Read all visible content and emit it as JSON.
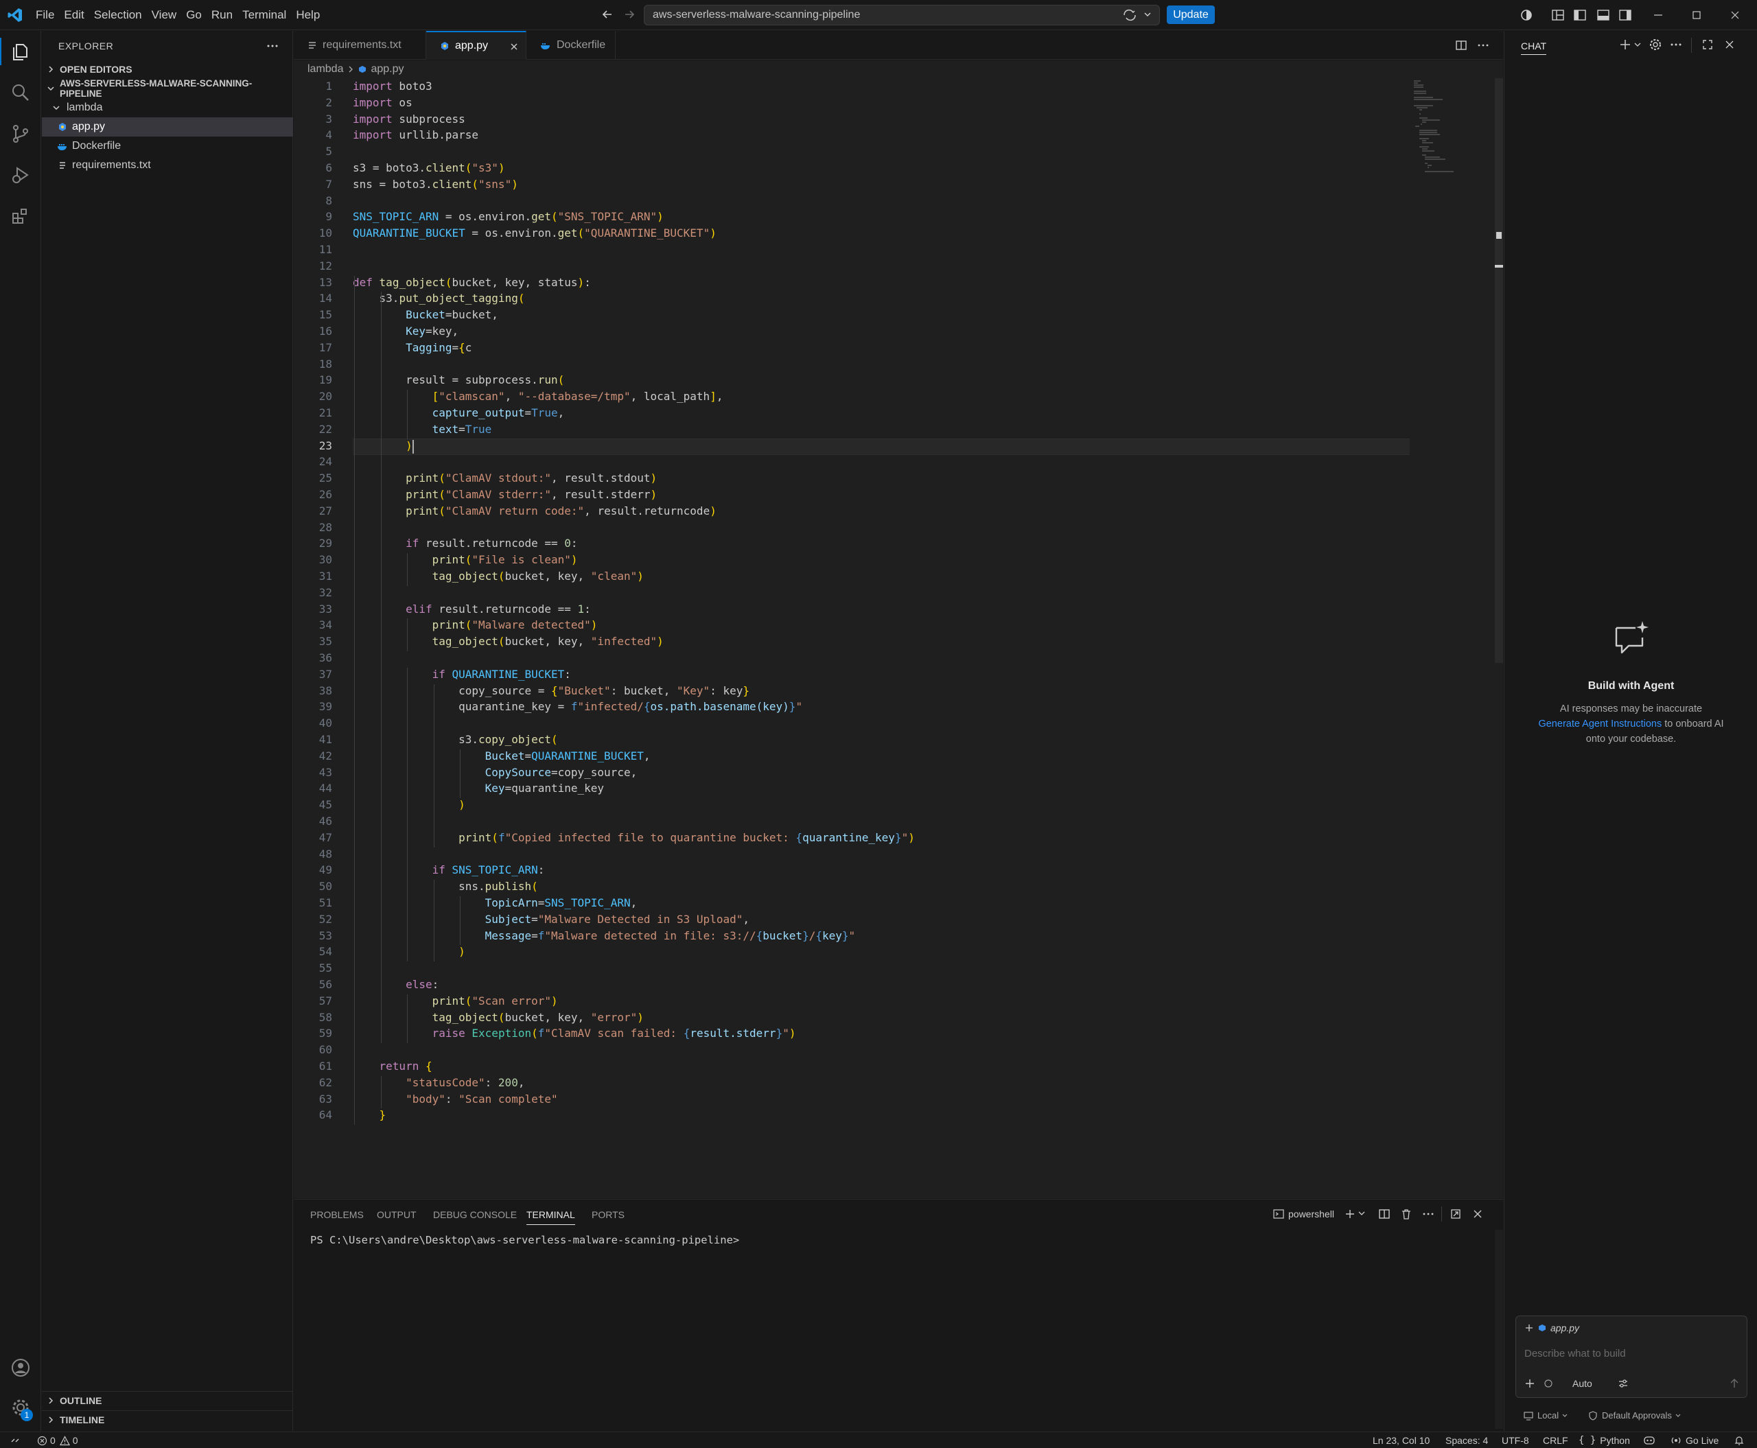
{
  "menu": [
    "File",
    "Edit",
    "Selection",
    "View",
    "Go",
    "Run",
    "Terminal",
    "Help"
  ],
  "command_center": {
    "text": "aws-serverless-malware-scanning-pipeline"
  },
  "update_label": "Update",
  "explorer": {
    "title": "EXPLORER",
    "open_editors": "OPEN EDITORS",
    "project": "AWS-SERVERLESS-MALWARE-SCANNING-PIPELINE",
    "folder": "lambda",
    "files": [
      "app.py",
      "Dockerfile",
      "requirements.txt"
    ],
    "outline": "OUTLINE",
    "timeline": "TIMELINE"
  },
  "tabs": [
    "requirements.txt",
    "app.py",
    "Dockerfile"
  ],
  "breadcrumb": {
    "folder": "lambda",
    "file": "app.py"
  },
  "code_lines": [
    "import boto3",
    "import os",
    "import subprocess",
    "import urllib.parse",
    "",
    "s3 = boto3.client(\"s3\")",
    "sns = boto3.client(\"sns\")",
    "",
    "SNS_TOPIC_ARN = os.environ.get(\"SNS_TOPIC_ARN\")",
    "QUARANTINE_BUCKET = os.environ.get(\"QUARANTINE_BUCKET\")",
    "",
    "",
    "def tag_object(bucket, key, status):",
    "    s3.put_object_tagging(",
    "        Bucket=bucket,",
    "        Key=key,",
    "        Tagging={c",
    "",
    "        result = subprocess.run(",
    "            [\"clamscan\", \"--database=/tmp\", local_path],",
    "            capture_output=True,",
    "            text=True",
    "        )",
    "",
    "        print(\"ClamAV stdout:\", result.stdout)",
    "        print(\"ClamAV stderr:\", result.stderr)",
    "        print(\"ClamAV return code:\", result.returncode)",
    "",
    "        if result.returncode == 0:",
    "            print(\"File is clean\")",
    "            tag_object(bucket, key, \"clean\")",
    "",
    "        elif result.returncode == 1:",
    "            print(\"Malware detected\")",
    "            tag_object(bucket, key, \"infected\")",
    "",
    "            if QUARANTINE_BUCKET:",
    "                copy_source = {\"Bucket\": bucket, \"Key\": key}",
    "                quarantine_key = f\"infected/{os.path.basename(key)}\"",
    "",
    "                s3.copy_object(",
    "                    Bucket=QUARANTINE_BUCKET,",
    "                    CopySource=copy_source,",
    "                    Key=quarantine_key",
    "                )",
    "",
    "                print(f\"Copied infected file to quarantine bucket: {quarantine_key}\")",
    "",
    "            if SNS_TOPIC_ARN:",
    "                sns.publish(",
    "                    TopicArn=SNS_TOPIC_ARN,",
    "                    Subject=\"Malware Detected in S3 Upload\",",
    "                    Message=f\"Malware detected in file: s3://{bucket}/{key}\"",
    "                )",
    "",
    "        else:",
    "            print(\"Scan error\")",
    "            tag_object(bucket, key, \"error\")",
    "            raise Exception(f\"ClamAV scan failed: {result.stderr}\")",
    "",
    "    return {",
    "        \"statusCode\": 200,",
    "        \"body\": \"Scan complete\"",
    "    }"
  ],
  "current_line": 23,
  "panel": {
    "tabs": [
      "PROBLEMS",
      "OUTPUT",
      "DEBUG CONSOLE",
      "TERMINAL",
      "PORTS"
    ],
    "active_tab": "TERMINAL",
    "shell": "powershell",
    "prompt": "PS C:\\Users\\andre\\Desktop\\aws-serverless-malware-scanning-pipeline>"
  },
  "chat": {
    "title": "CHAT",
    "heading": "Build with Agent",
    "line1": "AI responses may be inaccurate",
    "link": "Generate Agent Instructions",
    "line2_suffix": "to onboard AI",
    "line3": "onto your codebase.",
    "context_file": "app.py",
    "input_placeholder": "Describe what to build",
    "mode": "Auto",
    "location": "Local",
    "approvals": "Default Approvals"
  },
  "status": {
    "errors": "0",
    "warnings": "0",
    "position": "Ln 23, Col 10",
    "spaces": "Spaces: 4",
    "encoding": "UTF-8",
    "eol": "CRLF",
    "language": "Python",
    "golive": "Go Live",
    "accounts_badge": "1"
  }
}
